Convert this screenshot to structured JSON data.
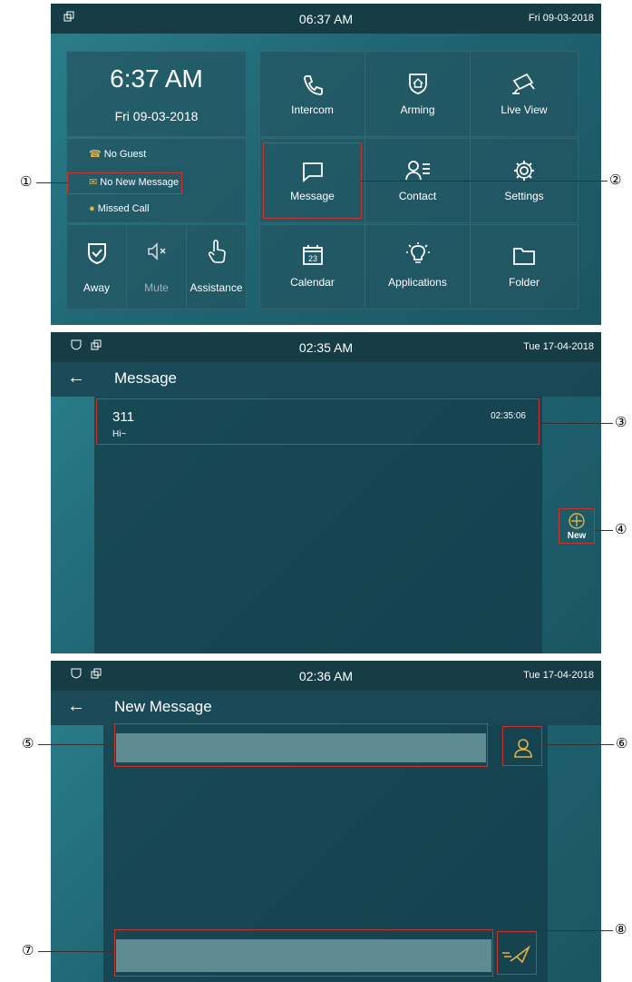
{
  "screen1": {
    "status_time": "06:37 AM",
    "status_date": "Fri  09-03-2018",
    "big_time": "6:37 AM",
    "big_date": "Fri 09-03-2018",
    "info": {
      "no_guest": "No Guest",
      "no_new_message": "No New Message",
      "missed_call": "Missed Call"
    },
    "quick": {
      "away": "Away",
      "mute": "Mute",
      "assistance": "Assistance"
    },
    "tiles": {
      "intercom": "Intercom",
      "arming": "Arming",
      "live_view": "Live View",
      "message": "Message",
      "contact": "Contact",
      "settings": "Settings",
      "calendar": "Calendar",
      "applications": "Applications",
      "folder": "Folder",
      "calendar_day": "23"
    }
  },
  "screen2": {
    "status_time": "02:35 AM",
    "status_date": "Tue   17-04-2018",
    "title": "Message",
    "message_item": {
      "sender": "311",
      "text": "Hi~",
      "time": "02:35:06"
    },
    "new_label": "New"
  },
  "screen3": {
    "status_time": "02:36 AM",
    "status_date": "Tue   17-04-2018",
    "title": "New Message"
  },
  "callouts": {
    "c1": "①",
    "c2": "②",
    "c3": "③",
    "c4": "④",
    "c5": "⑤",
    "c6": "⑥",
    "c7": "⑦",
    "c8": "⑧"
  },
  "colors": {
    "accent_gold": "#e0b24a",
    "highlight_red": "#c8352f",
    "status_bar": "#163c45"
  }
}
